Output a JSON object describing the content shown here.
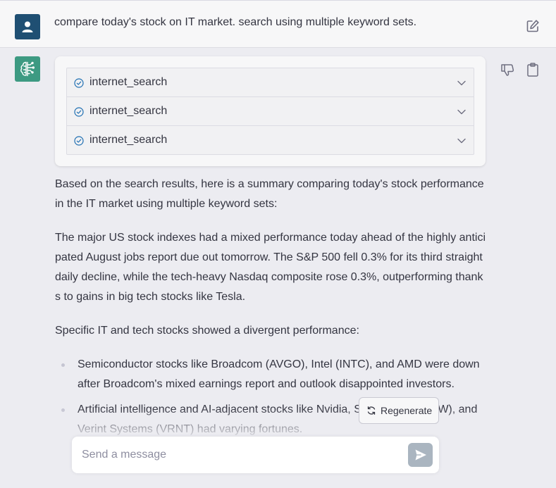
{
  "user_message": {
    "text": "compare today's stock on IT market. search using multiple keyword sets."
  },
  "tools": [
    {
      "label": "internet_search"
    },
    {
      "label": "internet_search"
    },
    {
      "label": "internet_search"
    }
  ],
  "answer": {
    "paragraphs": [
      "Based on the search results, here is a summary comparing today's stock performance in the IT market using multiple keyword sets:",
      "The major US stock indexes had a mixed performance today ahead of the highly anticipated August jobs report due out tomorrow. The S&P 500 fell 0.3% for its third straight daily decline, while the tech-heavy Nasdaq composite rose 0.3%, outperforming thanks to gains in big tech stocks like Tesla.",
      "Specific IT and tech stocks showed a divergent performance:"
    ],
    "bullets": [
      "Semiconductor stocks like Broadcom (AVGO), Intel (INTC), and AMD were down after Broadcom's mixed earnings report and outlook disappointed investors.",
      "Artificial intelligence and AI-adjacent stocks like Nvidia, ServiceNow (NOW), and Verint Systems (VRNT) had varying fortunes."
    ]
  },
  "regenerate": {
    "label": "Regenerate"
  },
  "composer": {
    "placeholder": "Send a message"
  },
  "colors": {
    "user_avatar": "#1f4f73",
    "bot_avatar": "#3d9a82",
    "send_button": "#aab5c0",
    "check_accent": "#1f6fb2"
  },
  "icons": {
    "user_avatar": "person-icon",
    "bot_avatar": "brain-circuit-icon",
    "edit": "edit-icon",
    "thumbs_down": "thumbs-down-icon",
    "copy": "clipboard-icon",
    "tool_status": "check-circle-icon",
    "expand": "chevron-down-icon",
    "regenerate": "refresh-icon",
    "send": "send-icon"
  }
}
